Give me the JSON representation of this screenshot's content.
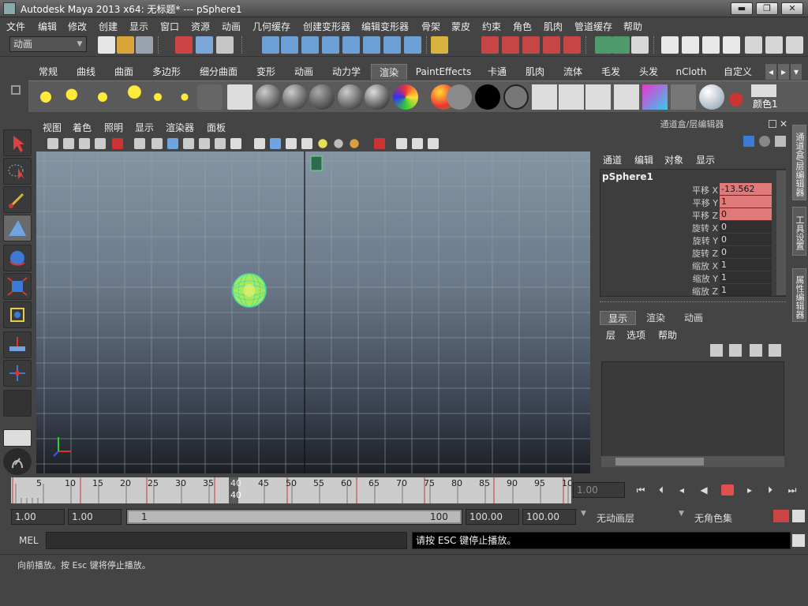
{
  "window": {
    "title": "Autodesk Maya 2013 x64: 无标题*   ---   pSphere1",
    "min": "▬",
    "max": "❐",
    "close": "✕"
  },
  "menubar": [
    "文件",
    "编辑",
    "修改",
    "创建",
    "显示",
    "窗口",
    "资源",
    "动画",
    "几何缓存",
    "创建变形器",
    "编辑变形器",
    "骨架",
    "蒙皮",
    "约束",
    "角色",
    "肌肉",
    "管道缓存",
    "帮助"
  ],
  "status": {
    "mode": "动画"
  },
  "shelf_tabs": [
    "常规",
    "曲线",
    "曲面",
    "多边形",
    "细分曲面",
    "变形",
    "动画",
    "动力学",
    "渲染",
    "PaintEffects",
    "卡通",
    "肌肉",
    "流体",
    "毛发",
    "头发",
    "nCloth",
    "自定义"
  ],
  "shelf_active": "渲染",
  "shelf_last_label": "颜色1",
  "viewport_menu": [
    "视图",
    "着色",
    "照明",
    "显示",
    "渲染器",
    "面板"
  ],
  "channel_box": {
    "title": "通道盒/层编辑器",
    "menu": [
      "通道",
      "编辑",
      "对象",
      "显示"
    ],
    "object": "pSphere1",
    "attrs": [
      {
        "label": "平移 X",
        "value": "-13.562",
        "keyed": true
      },
      {
        "label": "平移 Y",
        "value": "1",
        "keyed": true
      },
      {
        "label": "平移 Z",
        "value": "0",
        "keyed": true
      },
      {
        "label": "旋转 X",
        "value": "0",
        "keyed": false
      },
      {
        "label": "旋转 Y",
        "value": "0",
        "keyed": false
      },
      {
        "label": "旋转 Z",
        "value": "0",
        "keyed": false
      },
      {
        "label": "缩放 X",
        "value": "1",
        "keyed": false
      },
      {
        "label": "缩放 Y",
        "value": "1",
        "keyed": false
      },
      {
        "label": "缩放 Z",
        "value": "1",
        "keyed": false
      }
    ]
  },
  "layer_editor": {
    "tabs": [
      "显示",
      "渲染",
      "动画"
    ],
    "menu": [
      "层",
      "选项",
      "帮助"
    ]
  },
  "right_tabs": [
    "通道盒/层编辑器",
    "工具设置",
    "属性编辑器"
  ],
  "timeline": {
    "ticks": [
      "5",
      "10",
      "15",
      "20",
      "25",
      "30",
      "35",
      "40",
      "45",
      "50",
      "55",
      "60",
      "65",
      "70",
      "75",
      "80",
      "85",
      "90",
      "95",
      "10"
    ],
    "current": "40",
    "current_field": "1.00"
  },
  "range": {
    "start": "1.00",
    "playback_start": "1.00",
    "slider_left": "1",
    "slider_right": "100",
    "playback_end": "100.00",
    "end": "100.00",
    "anim_layer": "无动画层",
    "char_set": "无角色集"
  },
  "command": {
    "label": "MEL",
    "output": "请按 ESC 键停止播放。"
  },
  "help": "向前播放。按 Esc 键将停止播放。"
}
